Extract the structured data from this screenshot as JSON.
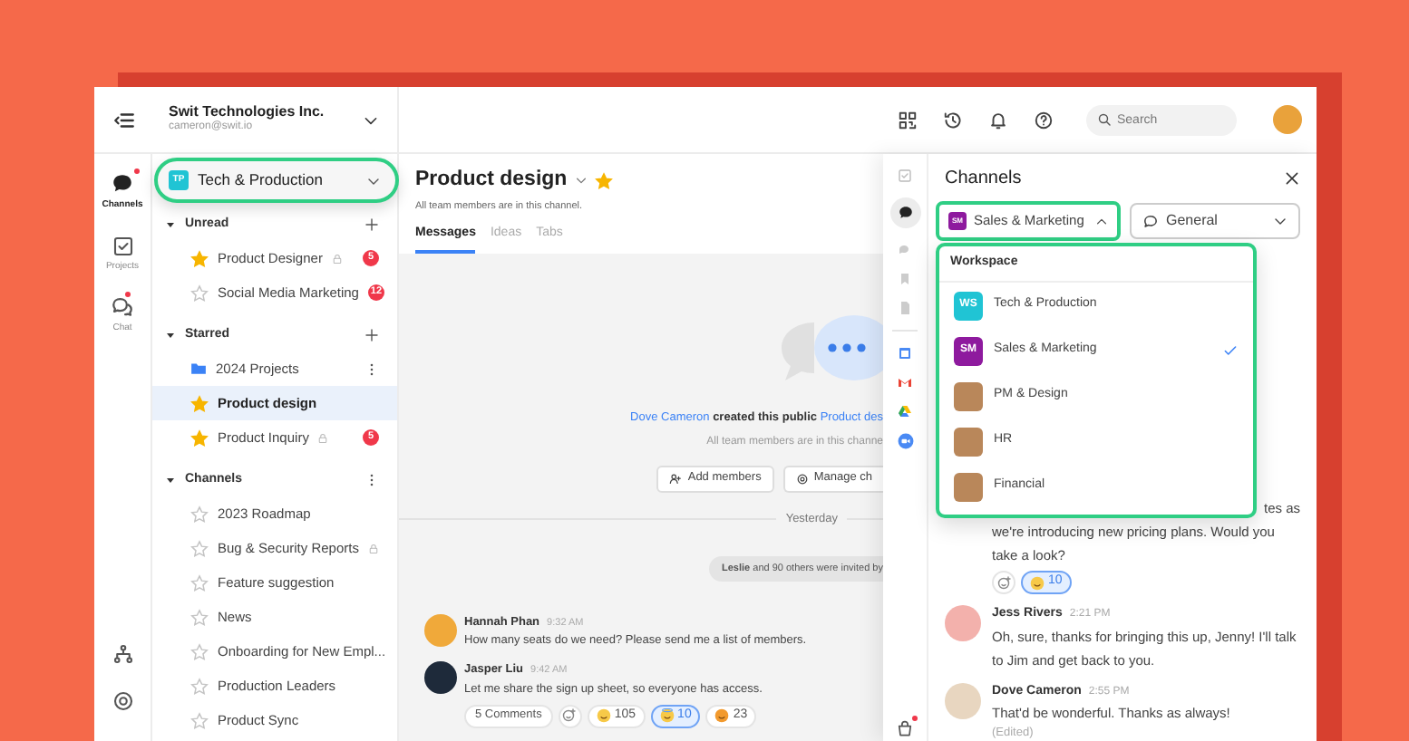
{
  "workspace_header": {
    "name": "Swit Technologies Inc.",
    "email": "cameron@swit.io"
  },
  "top_bar": {
    "search": {
      "placeholder": "Search"
    }
  },
  "rail": [
    {
      "label": "Channels",
      "kind": "channels",
      "selected": true,
      "unread": true
    },
    {
      "label": "Projects",
      "kind": "projects",
      "selected": false,
      "unread": false
    },
    {
      "label": "Chat",
      "kind": "chat",
      "selected": false,
      "unread": true
    }
  ],
  "workspace_picker": {
    "initials": "TP",
    "name": "Tech & Production"
  },
  "sidebar_sections": [
    {
      "title": "Unread",
      "kind": "add",
      "expanded": true,
      "items": [
        {
          "name": "Product Designer",
          "kind": "channel",
          "starred": true,
          "locked": true,
          "badge": "5",
          "selected": false
        },
        {
          "name": "Social Media Marketing",
          "kind": "channel",
          "starred": false,
          "locked": false,
          "badge": "12",
          "selected": false
        }
      ]
    },
    {
      "title": "Starred",
      "kind": "add",
      "expanded": true,
      "items": [
        {
          "name": "2024 Projects",
          "kind": "folder",
          "locked": false,
          "selected": false
        },
        {
          "name": "Product design",
          "kind": "channel",
          "starred": true,
          "locked": false,
          "selected": true
        },
        {
          "name": "Product Inquiry",
          "kind": "channel",
          "starred": true,
          "locked": true,
          "badge": "5",
          "selected": false
        }
      ]
    },
    {
      "title": "Channels",
      "kind": "more",
      "expanded": true,
      "items": [
        {
          "name": "2023 Roadmap",
          "kind": "channel",
          "starred": false,
          "locked": false,
          "selected": false
        },
        {
          "name": "Bug & Security Reports",
          "kind": "channel",
          "starred": false,
          "locked": true,
          "selected": false
        },
        {
          "name": "Feature suggestion",
          "kind": "channel",
          "starred": false,
          "locked": false,
          "selected": false
        },
        {
          "name": "News",
          "kind": "channel",
          "starred": false,
          "locked": false,
          "selected": false
        },
        {
          "name": "Onboarding for New Empl...",
          "kind": "channel",
          "starred": false,
          "locked": false,
          "selected": false
        },
        {
          "name": "Production Leaders",
          "kind": "channel",
          "starred": false,
          "locked": false,
          "selected": false
        },
        {
          "name": "Product Sync",
          "kind": "channel",
          "starred": false,
          "locked": false,
          "selected": false
        }
      ]
    }
  ],
  "channel": {
    "title": "Product design",
    "starred": true,
    "subtitle": "All team members are in this channel.",
    "tabs": [
      {
        "label": "Messages",
        "selected": true
      },
      {
        "label": "Ideas",
        "selected": false
      },
      {
        "label": "Tabs",
        "selected": false
      }
    ]
  },
  "intro": {
    "creator": "Dove Cameron",
    "text": "created this public",
    "channel_link": "Product des",
    "note": "All team members are in this channe",
    "buttons": [
      {
        "label": "Add members",
        "kind": "add"
      },
      {
        "label": "Manage ch",
        "kind": "manage"
      }
    ]
  },
  "date_divider": "Yesterday",
  "system_note": "**Leslie** and 90 others were invited by",
  "messages": [
    {
      "author": "Hannah Phan",
      "time": "9:32 AM",
      "text": "How many seats do we need? Please send me a list of members."
    },
    {
      "author": "Jasper Liu",
      "time": "9:42 AM",
      "text": "Let me share the sign up sheet, so everyone has access.",
      "comments": "5 Comments",
      "reactions": [
        {
          "kind": "grin",
          "count": "105",
          "selected": false
        },
        {
          "kind": "halo",
          "count": "10",
          "selected": true
        },
        {
          "kind": "party",
          "count": "23",
          "selected": false
        }
      ]
    }
  ],
  "side_panel": {
    "title": "Channels",
    "workspace_select": {
      "initials": "SM",
      "label": "Sales & Marketing",
      "expanded": true
    },
    "channel_select": {
      "label": "General"
    },
    "dropdown": {
      "heading": "Workspace",
      "items": [
        {
          "label": "Tech & Production",
          "kind": "initials",
          "initials": "WS",
          "color": "#20c4d4",
          "selected": false
        },
        {
          "label": "Sales & Marketing",
          "kind": "initials",
          "initials": "SM",
          "color": "#8e1a9e",
          "selected": true
        },
        {
          "label": "PM & Design",
          "kind": "photo",
          "selected": false
        },
        {
          "label": "HR",
          "kind": "photo",
          "selected": false
        },
        {
          "label": "Financial",
          "kind": "photo",
          "selected": false
        }
      ]
    },
    "messages": [
      {
        "text_fragment": "tes as",
        "text": "we're introducing new pricing plans. Would you take a look?",
        "reactions": [
          {
            "kind": "grin",
            "count": "10",
            "selected": true
          }
        ]
      },
      {
        "author": "Jess Rivers",
        "time": "2:21 PM",
        "text": "Oh, sure, thanks for bringing this up, Jenny! I'll talk to Jim and get back to you."
      },
      {
        "author": "Dove Cameron",
        "time": "2:55 PM",
        "text": "That'd be wonderful. Thanks as always!",
        "edited": "(Edited)"
      }
    ]
  }
}
